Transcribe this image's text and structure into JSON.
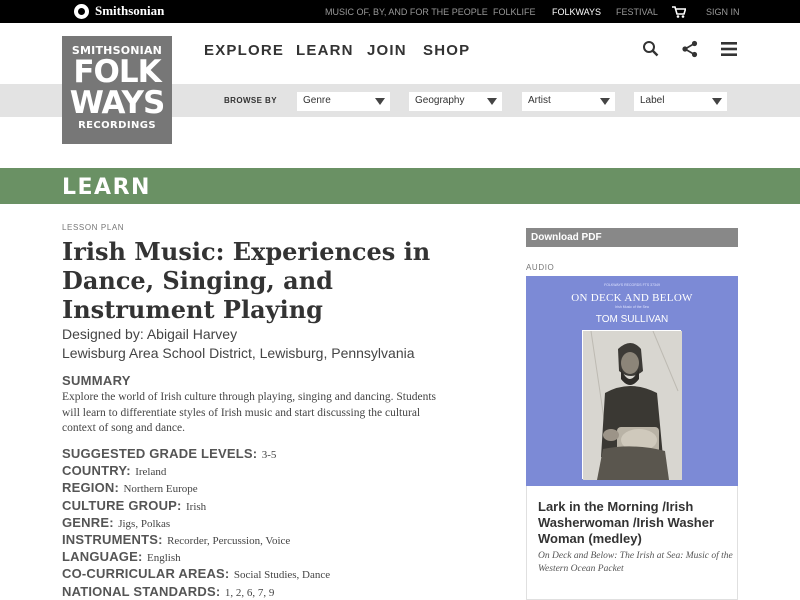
{
  "topbar": {
    "brand": "Smithsonian",
    "links": [
      "MUSIC OF, BY, AND FOR THE PEOPLE",
      "FOLKLIFE",
      "FOLKWAYS",
      "FESTIVAL"
    ],
    "active_link": "FOLKWAYS",
    "cart_icon": "cart-icon",
    "sign_in": "SIGN IN"
  },
  "logo": {
    "line1": "SMITHSONIAN",
    "line2": "FOLK",
    "line3": "WAYS",
    "line4": "RECORDINGS"
  },
  "nav": {
    "items": [
      "EXPLORE",
      "LEARN",
      "JOIN",
      "SHOP"
    ],
    "icons": [
      "search-icon",
      "share-icon",
      "menu-icon"
    ]
  },
  "browse": {
    "label": "BROWSE BY",
    "filters": [
      "Genre",
      "Geography",
      "Artist",
      "Label"
    ]
  },
  "section": {
    "title": "LEARN",
    "color": "#6a9164"
  },
  "lesson": {
    "type_label": "LESSON PLAN",
    "title": "Irish Music: Experiences in Dance, Singing, and Instrument Playing",
    "designer": "Designed by: Abigail Harvey",
    "school": "Lewisburg Area School District, Lewisburg, Pennsylvania",
    "summary_heading": "SUMMARY",
    "summary": "Explore the world of Irish culture through playing, singing and dancing. Students will learn to differentiate styles of Irish music and start discussing the cultural context of song and dance.",
    "facts": [
      {
        "label": "SUGGESTED GRADE LEVELS:",
        "value": "3-5"
      },
      {
        "label": "COUNTRY:",
        "value": "Ireland"
      },
      {
        "label": "REGION:",
        "value": "Northern Europe"
      },
      {
        "label": "CULTURE GROUP:",
        "value": "Irish"
      },
      {
        "label": "GENRE:",
        "value": "Jigs, Polkas"
      },
      {
        "label": "INSTRUMENTS:",
        "value": "Recorder, Percussion, Voice"
      },
      {
        "label": "LANGUAGE:",
        "value": "English"
      },
      {
        "label": "CO-CURRICULAR AREAS:",
        "value": "Social Studies, Dance"
      },
      {
        "label": "NATIONAL STANDARDS:",
        "value": "1, 2, 6, 7, 9"
      }
    ]
  },
  "sidebar": {
    "download_label": "Download PDF",
    "audio_label": "AUDIO",
    "album_cover": {
      "small_top": "FOLKWAYS RECORDS FTS 37349",
      "title": "ON DECK AND BELOW",
      "subtitle": "Irish Music of the Sea",
      "artist": "TOM SULLIVAN",
      "color": "#7c8ad6"
    },
    "track_title": "Lark in the Morning /Irish Washerwoman /Irish Washer Woman (medley)",
    "track_album": "On Deck and Below: The Irish at Sea: Music of the Western Ocean Packet"
  }
}
